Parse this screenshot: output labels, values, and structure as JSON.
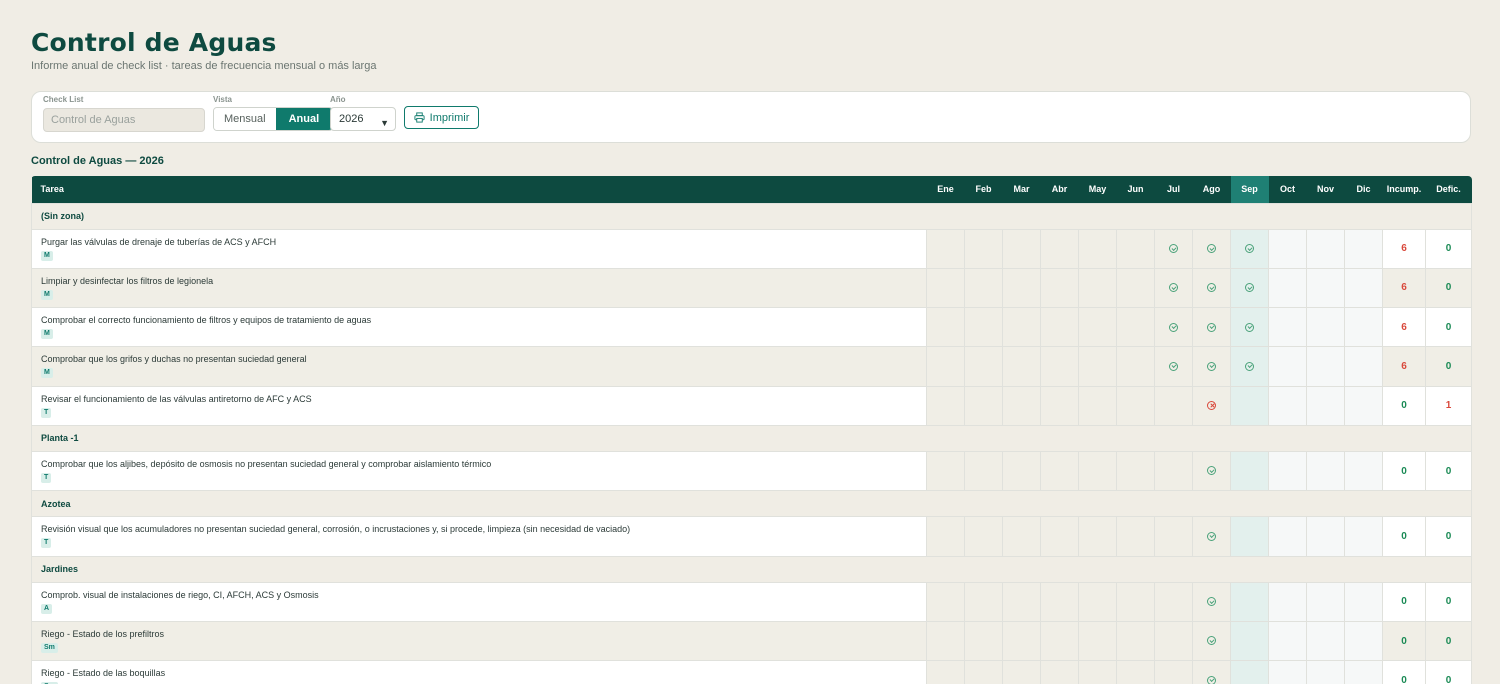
{
  "header": {
    "title": "Control de Aguas",
    "subtitle": "Informe anual de check list · tareas de frecuencia mensual o más larga"
  },
  "filters": {
    "checklist_label": "Check List",
    "checklist_value": "Control de Aguas",
    "view_label": "Vista",
    "view_options": [
      "Mensual",
      "Anual"
    ],
    "view_selected": "Anual",
    "year_label": "Año",
    "year_value": "2026",
    "print_label": "Imprimir"
  },
  "report": {
    "section_title": "Control de Aguas — 2026",
    "task_col": "Tarea",
    "months": [
      "Ene",
      "Feb",
      "Mar",
      "Abr",
      "May",
      "Jun",
      "Jul",
      "Ago",
      "Sep",
      "Oct",
      "Nov",
      "Dic"
    ],
    "current_month_index": 8,
    "incump_col": "Incump.",
    "defic_col": "Defic.",
    "zones": [
      {
        "name": "(Sin zona)",
        "tasks": [
          {
            "name": "Purgar las válvulas de drenaje de tuberías de ACS y AFCH",
            "freq": "M",
            "marks": {
              "6": "ok",
              "7": "ok",
              "8": "ok"
            },
            "incump": "6",
            "defic": "0"
          },
          {
            "name": "Limpiar y desinfectar los filtros de legionela",
            "freq": "M",
            "marks": {
              "6": "ok",
              "7": "ok",
              "8": "ok"
            },
            "incump": "6",
            "defic": "0"
          },
          {
            "name": "Comprobar el correcto funcionamiento de filtros y equipos de tratamiento de aguas",
            "freq": "M",
            "marks": {
              "6": "ok",
              "7": "ok",
              "8": "ok"
            },
            "incump": "6",
            "defic": "0"
          },
          {
            "name": "Comprobar que los grifos y duchas no presentan suciedad general",
            "freq": "M",
            "marks": {
              "6": "ok",
              "7": "ok",
              "8": "ok"
            },
            "incump": "6",
            "defic": "0"
          },
          {
            "name": "Revisar el funcionamiento de las válvulas antiretorno de AFC y ACS",
            "freq": "T",
            "marks": {
              "7": "ko"
            },
            "incump": "0",
            "defic": "1"
          }
        ]
      },
      {
        "name": "Planta -1",
        "tasks": [
          {
            "name": "Comprobar que los aljibes, depósito de osmosis no presentan suciedad general y comprobar aislamiento térmico",
            "freq": "T",
            "marks": {
              "7": "ok"
            },
            "incump": "0",
            "defic": "0"
          }
        ]
      },
      {
        "name": "Azotea",
        "tasks": [
          {
            "name": "Revisión visual que los acumuladores no presentan suciedad general, corrosión, o incrustaciones y, si procede, limpieza (sin necesidad de vaciado)",
            "freq": "T",
            "marks": {
              "7": "ok"
            },
            "incump": "0",
            "defic": "0"
          }
        ]
      },
      {
        "name": "Jardines",
        "tasks": [
          {
            "name": "Comprob. visual de instalaciones de riego, CI, AFCH, ACS y Osmosis",
            "freq": "A",
            "marks": {
              "7": "ok"
            },
            "incump": "0",
            "defic": "0"
          },
          {
            "name": "Riego - Estado de los prefiltros",
            "freq": "Sm",
            "marks": {
              "7": "ok"
            },
            "incump": "0",
            "defic": "0"
          },
          {
            "name": "Riego - Estado de las boquillas",
            "freq": "Sm",
            "marks": {
              "7": "ok"
            },
            "incump": "0",
            "defic": "0"
          }
        ]
      }
    ]
  }
}
